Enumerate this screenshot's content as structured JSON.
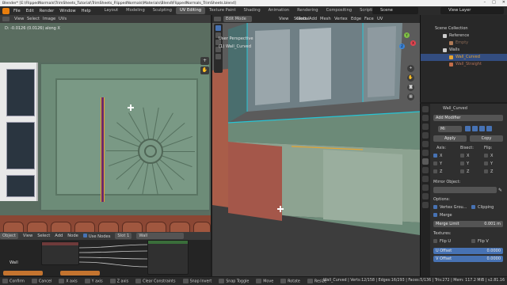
{
  "window_title": "Blender* [E:\\FlippedNormals\\TrimSheets_Tutorial\\TrimSheets_FlippedNormals\\Materials\\Blend\\FlippedNormals_TrimSheets.blend]",
  "menu": [
    "File",
    "Edit",
    "Render",
    "Window",
    "Help"
  ],
  "workspace_tabs": [
    "Layout",
    "Modeling",
    "Sculpting",
    "UV Editing",
    "Texture Paint",
    "Shading",
    "Animation",
    "Rendering",
    "Compositing",
    "Scripting"
  ],
  "active_workspace": "UV Editing",
  "scene_name": "Scene",
  "view_layer": "View Layer",
  "uv_editor": {
    "header_items": [
      "View",
      "Select",
      "Image",
      "UVs"
    ],
    "hint": "D: -0.0126 (0.0126) along X"
  },
  "node_editor": {
    "header_items": [
      "Object",
      "View",
      "Select",
      "Add",
      "Node"
    ],
    "use_nodes_label": "Use Nodes",
    "slot_label": "Slot 1",
    "material_name": "Wall",
    "node_label": "Wall"
  },
  "viewport": {
    "mode": "Edit Mode",
    "header_items": [
      "View",
      "Select",
      "Add",
      "Mesh",
      "Vertex",
      "Edge",
      "Face",
      "UV"
    ],
    "transform_orientation": "Global",
    "perspective_label": "User Perspective",
    "object_label": "(1) Wall_Curved"
  },
  "outliner": {
    "root": "Scene Collection",
    "rows": [
      {
        "name": "Reference",
        "color": "#cccccc",
        "selected": false
      },
      {
        "name": "Empty",
        "color": "#b07b57",
        "selected": false
      },
      {
        "name": "Walls",
        "color": "#cccccc",
        "selected": false
      },
      {
        "name": "Wall_Curved",
        "color": "#e6a431",
        "selected": true
      },
      {
        "name": "Wall_Straight",
        "color": "#c26d4a",
        "selected": false
      }
    ]
  },
  "properties": {
    "object_name": "Wall_Curved",
    "add_modifier": "Add Modifier",
    "modifier_name": "Mi",
    "apply_label": "Apply",
    "copy_label": "Copy",
    "axis_label": "Axis:",
    "bisect_label": "Bisect:",
    "flip_label": "Flip:",
    "axes": [
      {
        "name": "X",
        "axis": true,
        "bisect": false,
        "flip": false
      },
      {
        "name": "Y",
        "axis": false,
        "bisect": false,
        "flip": false
      },
      {
        "name": "Z",
        "axis": false,
        "bisect": false,
        "flip": false
      }
    ],
    "mirror_object_label": "Mirror Object:",
    "options_label": "Options:",
    "vertex_groups_label": "Vertex Grou...",
    "clipping_label": "Clipping",
    "merge_label": "Merge",
    "merge_limit_label": "Merge Limit",
    "merge_limit_value": "0.001 m",
    "textures_label": "Textures:",
    "flip_u_label": "Flip U",
    "flip_v_label": "Flip V",
    "u_offset_label": "U Offset",
    "u_offset_value": "0.0000",
    "v_offset_label": "V Offset",
    "v_offset_value": "0.0000"
  },
  "statusbar": {
    "items": [
      "Confirm",
      "Cancel",
      "X axis",
      "Y axis",
      "Z axis",
      "Clear Constraints",
      "Snap Invert",
      "Snap Toggle",
      "Move",
      "Rotate",
      "Resize"
    ],
    "stats": "Wall_Curved | Verts:12/158 | Edges:16/293 | Faces:5/136 | Tris:272 | Mem: 117.2 MiB | v2.81.16"
  }
}
